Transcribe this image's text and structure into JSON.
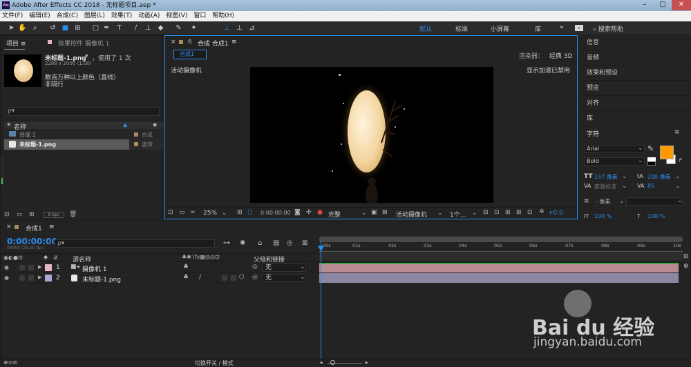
{
  "window": {
    "title": "Adobe After Effects CC 2018 - 无标题项目.aep *",
    "logo": "Ae"
  },
  "menu": [
    "文件(F)",
    "编辑(E)",
    "合成(C)",
    "图层(L)",
    "效果(T)",
    "动画(A)",
    "视图(V)",
    "窗口",
    "帮助(H)"
  ],
  "workspaces": {
    "default": "默认",
    "standard": "标准",
    "small_screen": "小屏幕",
    "library": "库",
    "more": "»",
    "search_help": "搜索帮助"
  },
  "project": {
    "tab_label": "项目",
    "effects_tab": "效果控件 摄像机 1",
    "selected_name": "未标题-1.png",
    "used_count": "，使用了 1 次",
    "dims": "2288 x 2000 (1.00)",
    "colors": "数百万种以上颜色（直线）",
    "interlace": "非隔行",
    "search_placeholder": "ρ▾",
    "col_name": "名称",
    "items": [
      {
        "name": "合成 1",
        "type": "合成",
        "color": "#a78d5d"
      },
      {
        "name": "未标题-1.png",
        "type": "波背",
        "color": "#a78d5d"
      }
    ],
    "bpc": "8 bpc"
  },
  "comp_viewer": {
    "tab_label": "合成 合成1",
    "comp_button": "合成1",
    "renderer_label": "渲染器：",
    "renderer_value": "经典 3D",
    "active_camera": "活动摄像机",
    "gpu_note": "显示加速已禁用",
    "zoom": "25%",
    "timecode": "0:00:00:00",
    "quality": "完整",
    "view": "活动摄像机",
    "views_count": "1个...",
    "exposure": "+0.0"
  },
  "right_panels": [
    "信息",
    "音频",
    "效果和预设",
    "预览",
    "对齐",
    "库"
  ],
  "character": {
    "title": "字符",
    "font": "Arial",
    "style": "Bold",
    "size": "157 像素",
    "leading": "200 像素",
    "kerning": "度量标准",
    "tracking": "85",
    "stroke": "- 像素",
    "vscale": "100 %",
    "hscale": "100 %",
    "fill_color": "#ff9900"
  },
  "timeline": {
    "tab_label": "合成1",
    "timecode": "0:00:00:00",
    "fps_note": "00000 (25.00 fps)",
    "col_source": "源名称",
    "col_parent": "父级和链接",
    "ticks": [
      "00s",
      "01s",
      "02s",
      "03s",
      "04s",
      "05s",
      "06s",
      "07s",
      "08s",
      "09s",
      "10s"
    ],
    "layers": [
      {
        "num": "1",
        "name": "摄像机 1",
        "parent": "无",
        "label_color": "#e7b5c0",
        "bar_color": "#b88a92"
      },
      {
        "num": "2",
        "name": "未标题-1.png",
        "parent": "无",
        "label_color": "#a9a9d6",
        "bar_color": "#8d87a6"
      }
    ],
    "toggle_label": "切换开关 / 模式"
  },
  "watermark": {
    "brand": "Bai du 经验",
    "url": "jingyan.baidu.com"
  }
}
